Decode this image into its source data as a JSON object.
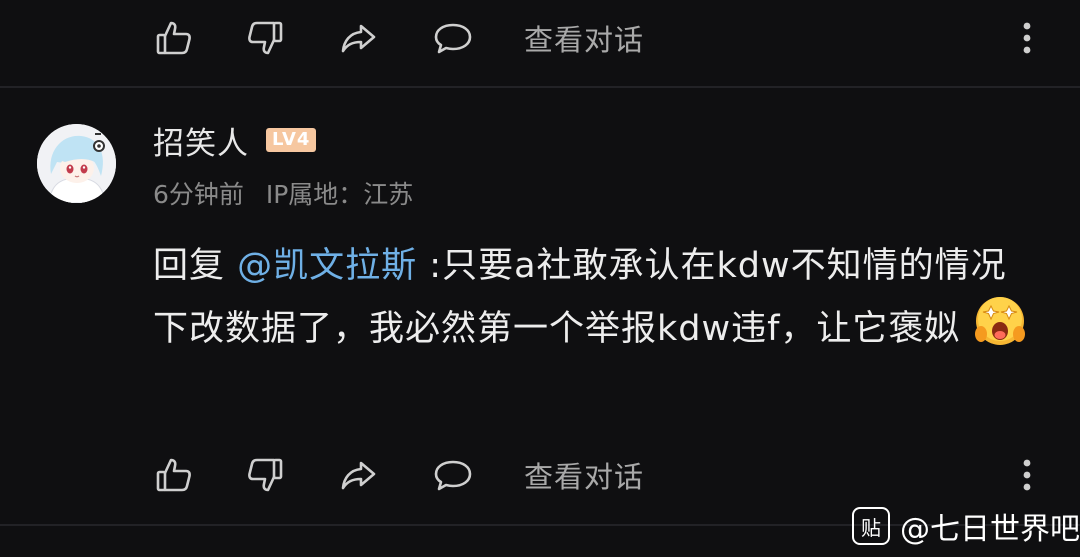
{
  "actions": {
    "like_icon": "thumbs-up-icon",
    "dislike_icon": "thumbs-down-icon",
    "share_icon": "share-icon",
    "reply_icon": "comment-bubble-icon",
    "view_label": "查看对话",
    "more_icon": "more-vertical-icon"
  },
  "comment": {
    "username": "招笑人",
    "level": "LV4",
    "time": "6分钟前",
    "location": "IP属地：江苏",
    "reply_prefix": "回复 ",
    "mention": "@凯文拉斯",
    "text": " :只要a社敢承认在kdw不知情的情况下改数据了，我必然第一个举报kdw违f，让它褒姒",
    "emoji": "star-struck-emoji"
  },
  "watermark": {
    "icon_label": "贴",
    "text": "@七日世界吧"
  },
  "colors": {
    "background": "#0f0f11",
    "mention": "#6fb0e6",
    "level_badge": "#f6c7a0"
  }
}
